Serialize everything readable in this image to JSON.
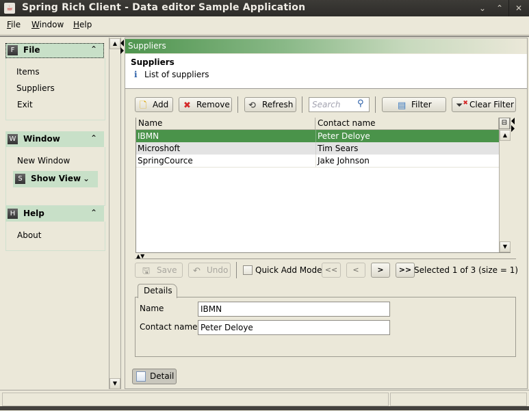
{
  "window": {
    "title": "Spring Rich Client - Data editor Sample Application",
    "controls": {
      "minimize": "⌄",
      "maximize": "⌃",
      "close": "✕"
    }
  },
  "menubar": [
    {
      "label": "File",
      "mnemonic": "F",
      "rest": "ile"
    },
    {
      "label": "Window",
      "mnemonic": "W",
      "rest": "indow"
    },
    {
      "label": "Help",
      "mnemonic": "H",
      "rest": "elp"
    }
  ],
  "sidebar": {
    "groups": [
      {
        "badge": "F",
        "label": "File",
        "chevron": "⌃",
        "items": [
          "Items",
          "Suppliers",
          "Exit"
        ]
      },
      {
        "badge": "W",
        "label": "Window",
        "chevron": "⌃",
        "items": [
          "New Window"
        ],
        "subgroup": {
          "badge": "S",
          "label": "Show View",
          "chevron": "⌄"
        }
      },
      {
        "badge": "H",
        "label": "Help",
        "chevron": "⌃",
        "items": [
          "About"
        ]
      }
    ]
  },
  "pane": {
    "header": "Suppliers",
    "title": "Suppliers",
    "info_icon": "i",
    "description": "List of suppliers"
  },
  "toolbar": {
    "add": "Add",
    "remove": "Remove",
    "refresh": "Refresh",
    "search_placeholder": "Search",
    "filter": "Filter",
    "clear_filter": "Clear Filter"
  },
  "table": {
    "columns": [
      "Name",
      "Contact name"
    ],
    "rows": [
      {
        "name": "IBMN",
        "contact": "Peter Deloye",
        "selected": true
      },
      {
        "name": "Microshoft",
        "contact": "Tim Sears",
        "selected": false
      },
      {
        "name": "SpringCource",
        "contact": "Jake Johnson",
        "selected": false
      }
    ]
  },
  "editor": {
    "save": "Save",
    "undo": "Undo",
    "quick_add_mode": "Quick Add Mode",
    "quick_add_checked": false,
    "nav": {
      "first": "<<",
      "prev": "<",
      "next": ">",
      "last": ">>"
    },
    "selection_status": "Selected 1 of 3 (size = 1)"
  },
  "details": {
    "tab": "Details",
    "fields": [
      {
        "label": "Name",
        "value": "IBMN"
      },
      {
        "label": "Contact name",
        "value": "Peter Deloye"
      }
    ]
  },
  "detail_button": "Detail",
  "colors": {
    "selection": "#4a934a",
    "group_header": "#c8e0c8",
    "background": "#ebe8d9"
  }
}
